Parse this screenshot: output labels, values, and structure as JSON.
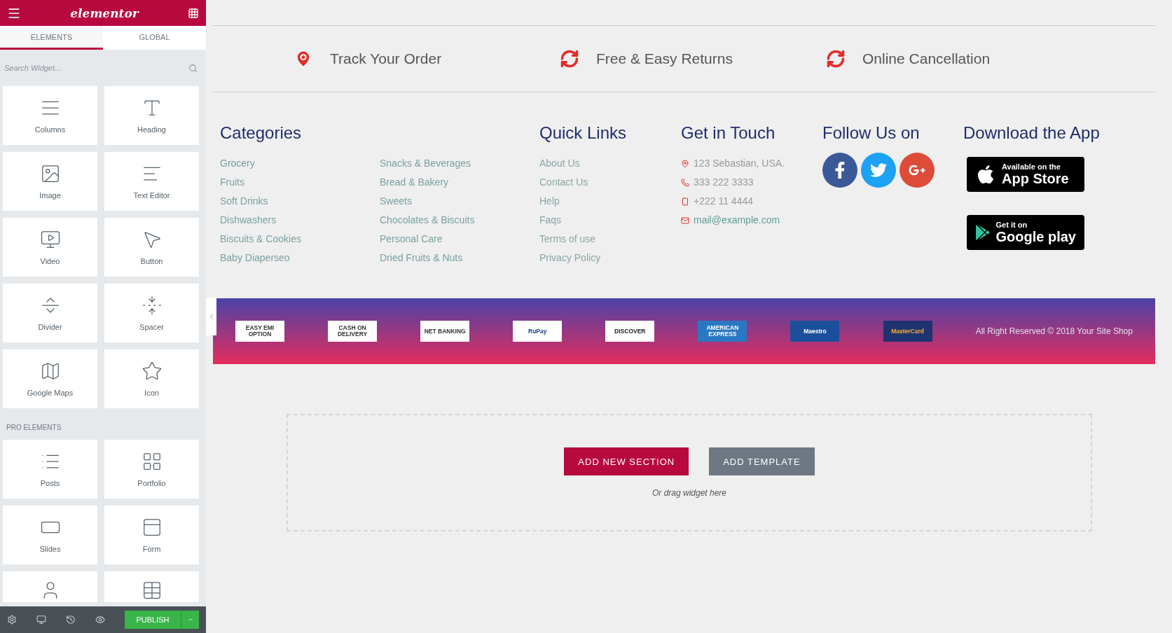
{
  "sidebar": {
    "logo": "elementor",
    "tabs": [
      {
        "label": "ELEMENTS",
        "selected": true
      },
      {
        "label": "GLOBAL",
        "selected": false
      }
    ],
    "search": {
      "placeholder": "Search Widget..."
    },
    "widgets": [
      {
        "label": "Columns"
      },
      {
        "label": "Heading"
      },
      {
        "label": "Image"
      },
      {
        "label": "Text Editor"
      },
      {
        "label": "Video"
      },
      {
        "label": "Button"
      },
      {
        "label": "Divider"
      },
      {
        "label": "Spacer"
      },
      {
        "label": "Google Maps"
      },
      {
        "label": "Icon"
      }
    ],
    "pro_section": "PRO ELEMENTS",
    "pro_widgets": [
      {
        "label": "Posts",
        "cut": false
      },
      {
        "label": "Portfolio",
        "cut": false
      },
      {
        "label": "Slides",
        "cut": false
      },
      {
        "label": "Form",
        "cut": false
      },
      {
        "cut": true
      },
      {
        "cut": true
      }
    ],
    "publish": "PUBLISH"
  },
  "features": [
    {
      "label": "Track Your Order"
    },
    {
      "label": "Free & Easy Returns"
    },
    {
      "label": "Online Cancellation"
    }
  ],
  "categories": {
    "title": "Categories",
    "column_1": [
      "Grocery",
      "Fruits",
      "Soft Drinks",
      "Dishwashers",
      "Biscuits & Cookies",
      "Baby Diaperseo"
    ],
    "column_2": [
      "Snacks & Beverages",
      "Bread & Bakery",
      "Sweets",
      "Chocolates & Biscuits",
      "Personal Care",
      "Dried Fruits & Nuts"
    ]
  },
  "quick_links": {
    "title": "Quick Links",
    "items": [
      "About Us",
      "Contact Us",
      "Help",
      "Faqs",
      "Terms of use",
      "Privacy Policy"
    ]
  },
  "contact": {
    "title": "Get in Touch",
    "items": [
      {
        "kind": "address",
        "text": "123 Sebastian, USA."
      },
      {
        "kind": "phone",
        "text": "333 222 3333"
      },
      {
        "kind": "mobile",
        "text": "+222 11 4444"
      },
      {
        "kind": "email",
        "text": "mail@example.com"
      }
    ]
  },
  "social": {
    "title": "Follow Us on",
    "items": [
      {
        "kind": "facebook",
        "color": "#3b5998"
      },
      {
        "kind": "twitter",
        "color": "#1da1f2"
      },
      {
        "kind": "google",
        "color": "#dd4b39"
      }
    ]
  },
  "apps": {
    "title": "Download the App",
    "items": [
      {
        "kind": "apple",
        "small": "Available on the",
        "big": "App Store"
      },
      {
        "kind": "google",
        "small": "Get it on",
        "big": "Google play"
      }
    ]
  },
  "payments": [
    {
      "kind": "plain",
      "text": "EASY EMI OPTION"
    },
    {
      "kind": "plain",
      "text": "CASH ON DELIVERY"
    },
    {
      "kind": "plain",
      "text": "NET BANKING"
    },
    {
      "kind": "rupay",
      "text": "RuPay"
    },
    {
      "kind": "discover",
      "text": "DISCOVER"
    },
    {
      "kind": "amex",
      "text": "AMERICAN EXPRESS"
    },
    {
      "kind": "maestro",
      "text": "Maestro"
    },
    {
      "kind": "mastercard",
      "text": "MasterCard"
    }
  ],
  "copyright": "All Right Reserved © 2018 Your Site Shop",
  "dropzone": {
    "primary": "ADD NEW SECTION",
    "secondary": "ADD TEMPLATE",
    "hint": "Or drag widget here"
  }
}
